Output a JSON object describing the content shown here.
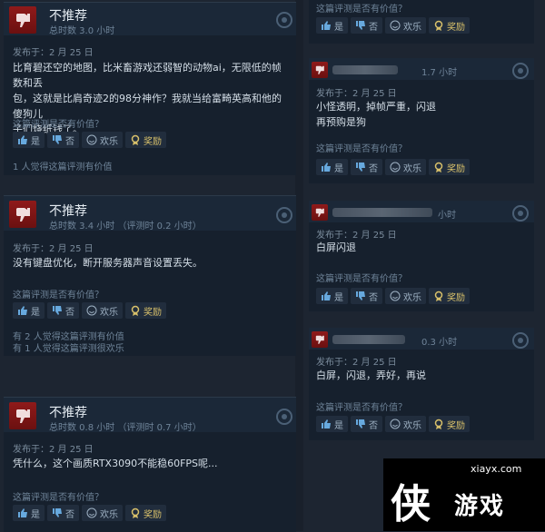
{
  "labels": {
    "not_recommended": "不推荐",
    "posted": "发布于：2 月 25 日",
    "helpful_question": "这篇评测是否有价值？",
    "yes": "是",
    "no": "否",
    "funny": "欢乐",
    "award": "奖励"
  },
  "left_reviews": [
    {
      "verdict": "不推荐",
      "hours": "总时数 3.0 小时",
      "text_lines": [
        "比育碧还空的地图，比米畜游戏还弱智的动物ai，无限低的帧数和丢",
        "包，这就是比肩奇迹2的98分神作？我就当给富畸英高和他的傻狗儿",
        "子们烧纸钱了。"
      ],
      "stats": [
        "1 人觉得这篇评测有价值"
      ]
    },
    {
      "verdict": "不推荐",
      "hours": "总时数 3.4 小时  （评测时 0.2 小时）",
      "text_lines": [
        "没有键盘优化，断开服务器声音设置丢失。"
      ],
      "stats": [
        "有 2 人觉得这篇评测有价值",
        "有 1 人觉得这篇评测很欢乐"
      ]
    },
    {
      "verdict": "不推荐",
      "hours": "总时数 0.8 小时  （评测时 0.7 小时）",
      "text_lines": [
        "凭什么，这个画质RTX3090不能稳60FPS呢..."
      ],
      "stats": []
    }
  ],
  "right_reviews": [
    {
      "hours": "1.7 小时",
      "text_lines": [
        "小怪透明，掉帧严重，闪退",
        "再预购是狗"
      ]
    },
    {
      "hours": "小时",
      "text_lines": [
        "白屏闪退"
      ]
    },
    {
      "hours": "0.3 小时",
      "text_lines": [
        "白屏，闪退，弄好，再说"
      ]
    }
  ],
  "watermark": {
    "site": "xiayx.com",
    "logo_char": "侠",
    "word": "游戏"
  },
  "colors": {
    "thumb_red": "#8f1a1a",
    "award_gold": "#d8c06a",
    "background": "#1d2531"
  }
}
